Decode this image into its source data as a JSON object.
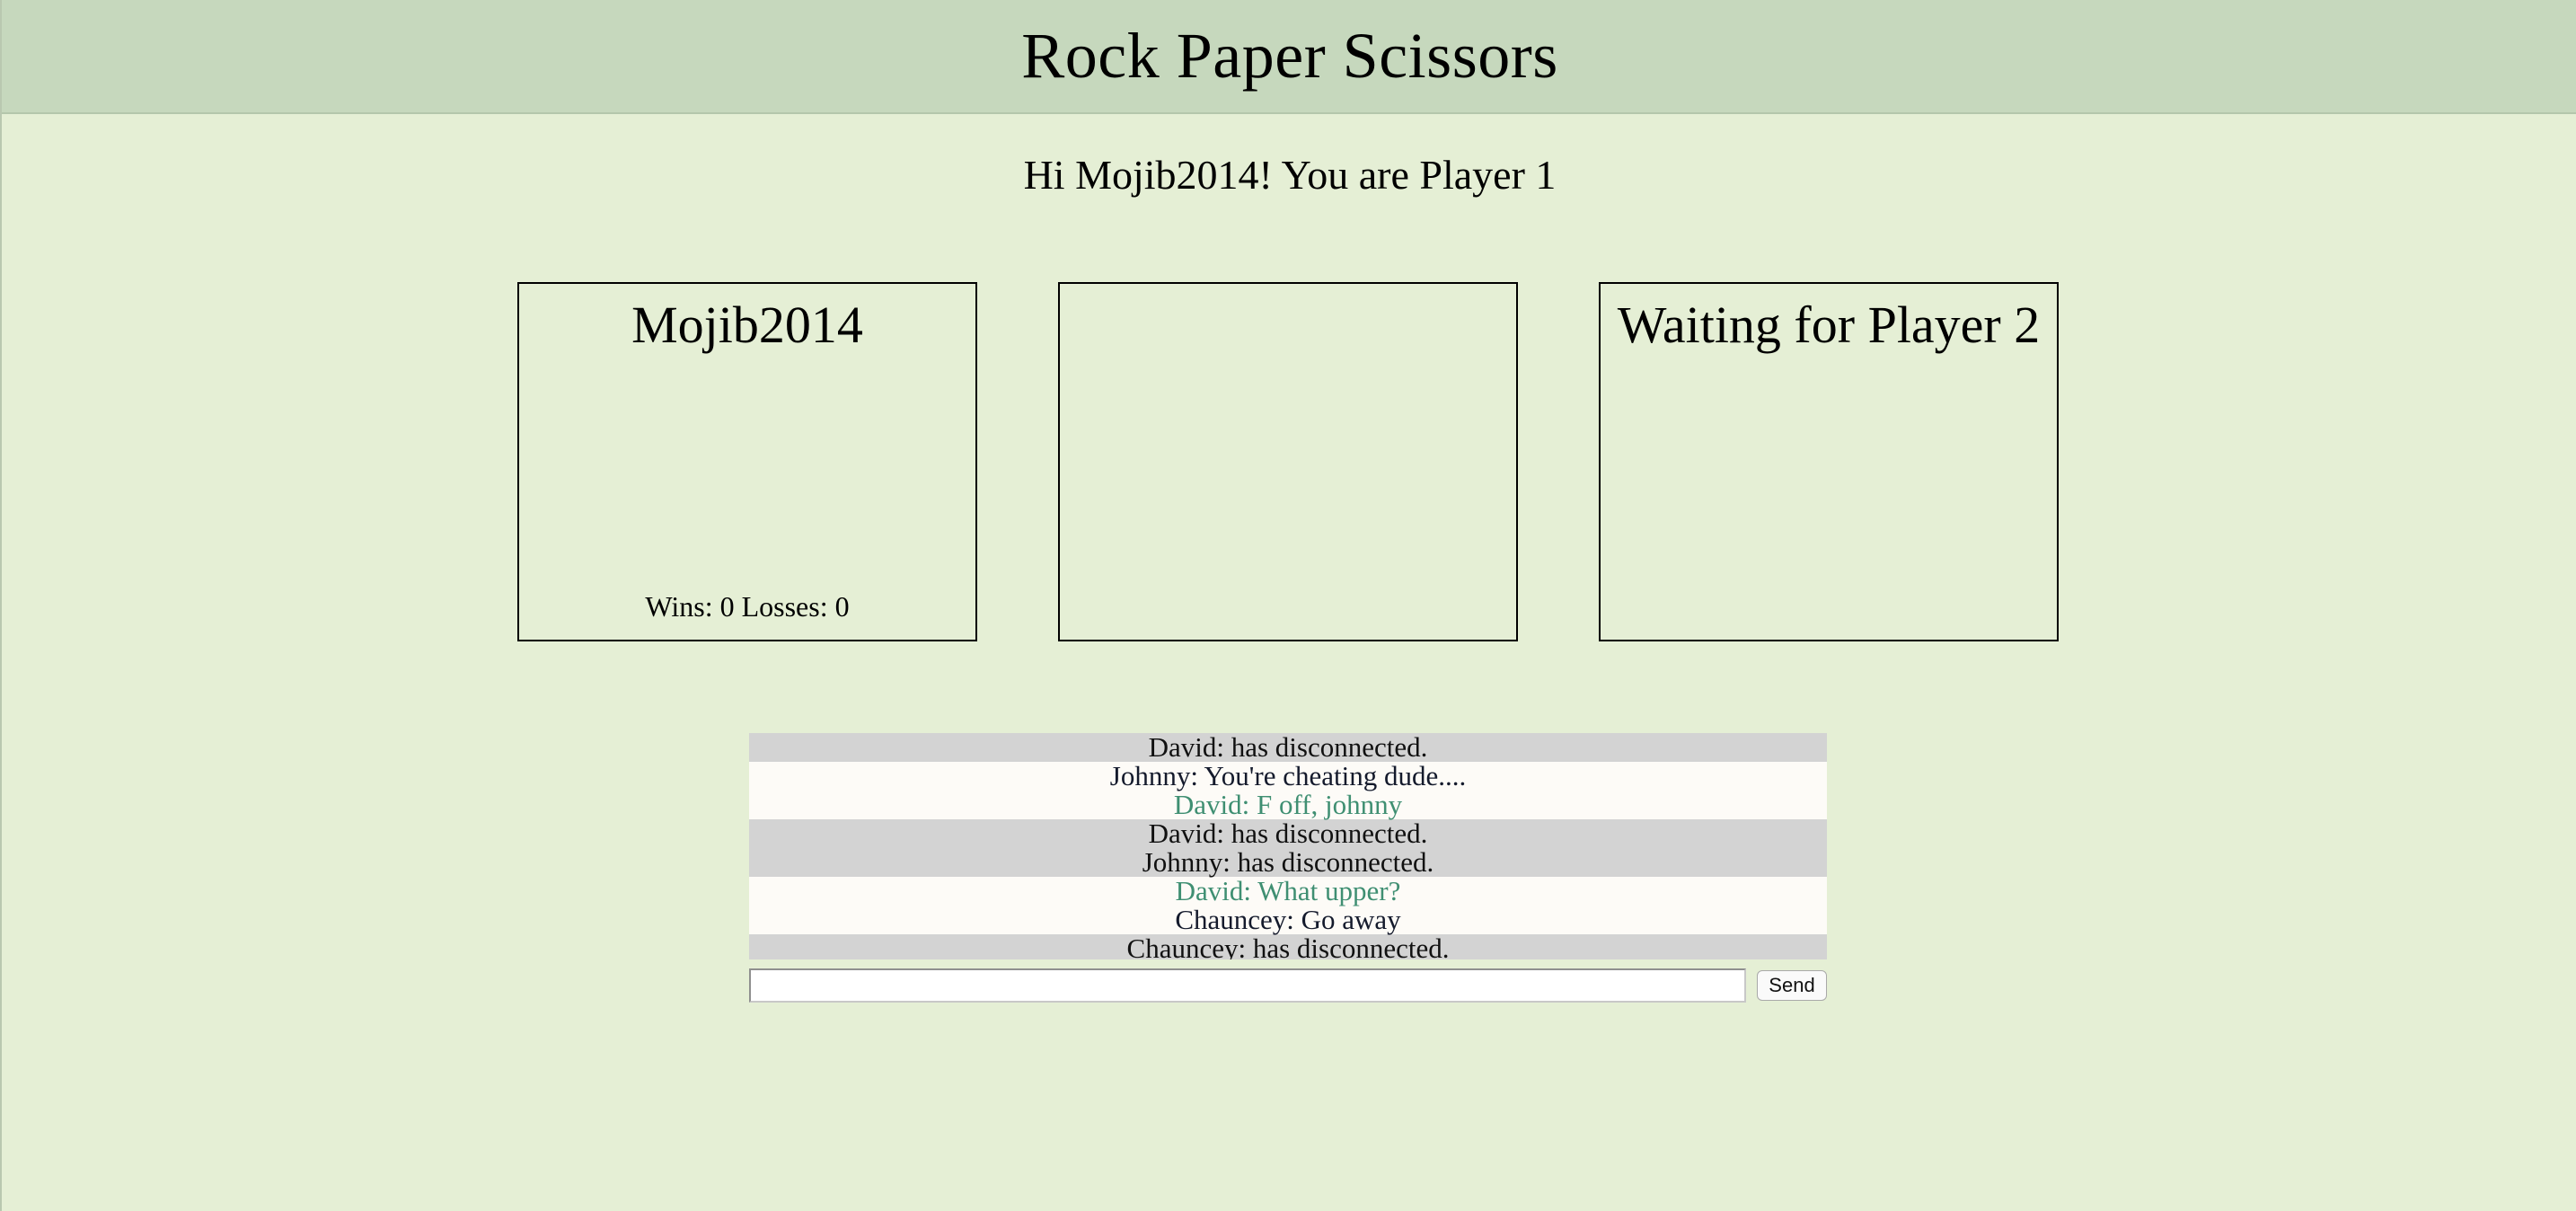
{
  "header": {
    "title": "Rock Paper Scissors"
  },
  "greeting": "Hi Mojib2014! You are Player 1",
  "players": {
    "player1": {
      "name": "Mojib2014",
      "wins_label": "Wins:",
      "wins": "0",
      "losses_label": "Losses:",
      "losses": "0"
    },
    "result": "",
    "player2": {
      "status": "Waiting for Player 2"
    }
  },
  "chat": {
    "messages": [
      {
        "text": "David: has disconnected.",
        "style": "system"
      },
      {
        "text": "Johnny: You're cheating dude....",
        "style": "normal"
      },
      {
        "text": "David: F off, johnny",
        "style": "self"
      },
      {
        "text": "David: has disconnected.",
        "style": "system"
      },
      {
        "text": "Johnny: has disconnected.",
        "style": "system"
      },
      {
        "text": "David: What upper?",
        "style": "self"
      },
      {
        "text": "Chauncey: Go away",
        "style": "normal"
      },
      {
        "text": "Chauncey: has disconnected.",
        "style": "system"
      }
    ],
    "input_value": "",
    "send_label": "Send"
  },
  "colors": {
    "page_background": "#e5efd5",
    "header_background": "#c6d8bd",
    "system_message_background": "#d3d3d3",
    "message_background": "#fdfbf7",
    "own_message_text": "#3f8f72"
  }
}
